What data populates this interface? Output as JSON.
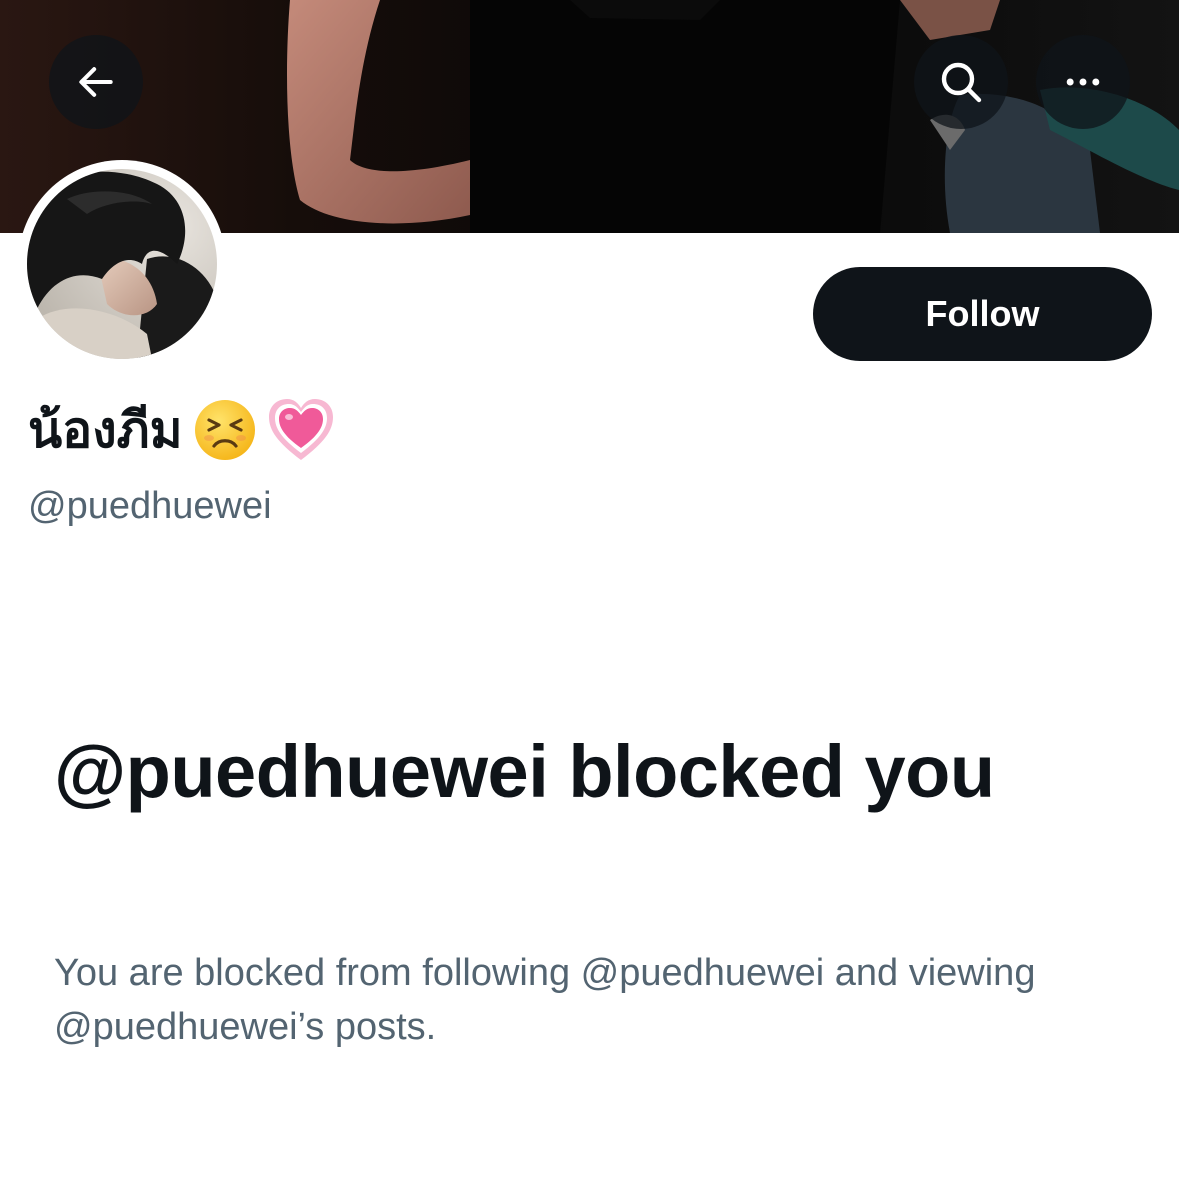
{
  "header": {
    "back_icon": "arrow-left-icon",
    "search_icon": "search-icon",
    "more_icon": "more-horizontal-icon"
  },
  "profile": {
    "display_name": "น้องภีม",
    "display_name_emojis": [
      "persevering-face-emoji",
      "growing-heart-emoji"
    ],
    "handle": "@puedhuewei",
    "follow_label": "Follow"
  },
  "blocked": {
    "title": "@puedhuewei blocked you",
    "description": "You are blocked from following @puedhuewei and viewing @puedhuewei’s posts."
  },
  "colors": {
    "primary_text": "#0f1419",
    "secondary_text": "#536471",
    "button_bg": "#0f1419",
    "button_text": "#ffffff",
    "background": "#ffffff"
  }
}
